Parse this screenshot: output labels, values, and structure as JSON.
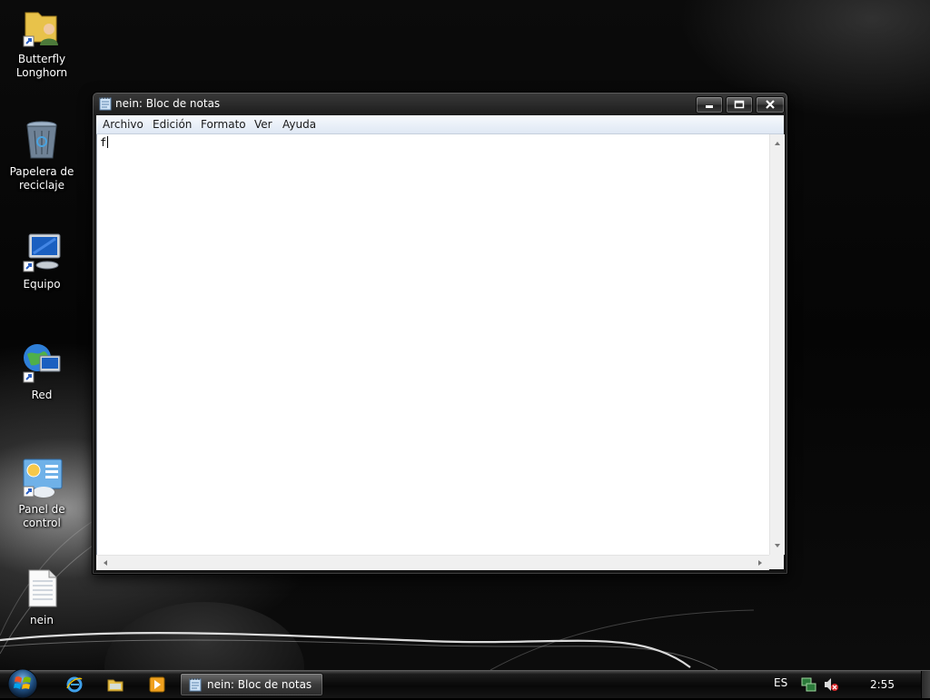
{
  "desktop": {
    "icons": [
      {
        "label": "Butterfly\nLonghorn",
        "icon": "user-folder-icon"
      },
      {
        "label": "Papelera de\nreciclaje",
        "icon": "recycle-bin-icon"
      },
      {
        "label": "Equipo",
        "icon": "computer-icon"
      },
      {
        "label": "Red",
        "icon": "network-icon"
      },
      {
        "label": "Panel de control",
        "icon": "control-panel-icon"
      },
      {
        "label": "nein",
        "icon": "text-file-icon"
      }
    ]
  },
  "window": {
    "title": "nein: Bloc de notas",
    "menu": [
      "Archivo",
      "Edición",
      "Formato",
      "Ver",
      "Ayuda"
    ],
    "content": "f"
  },
  "taskbar": {
    "task_label": "nein: Bloc de notas",
    "language": "ES",
    "clock": "2:55",
    "quick_launch": [
      "internet-explorer-icon",
      "folder-icon",
      "media-player-icon"
    ]
  },
  "colors": {
    "menu_bar": "#dfe8f4",
    "window_frame": "#1d1d1d",
    "taskbar": "#080808",
    "volume_muted": "#d6282a"
  }
}
